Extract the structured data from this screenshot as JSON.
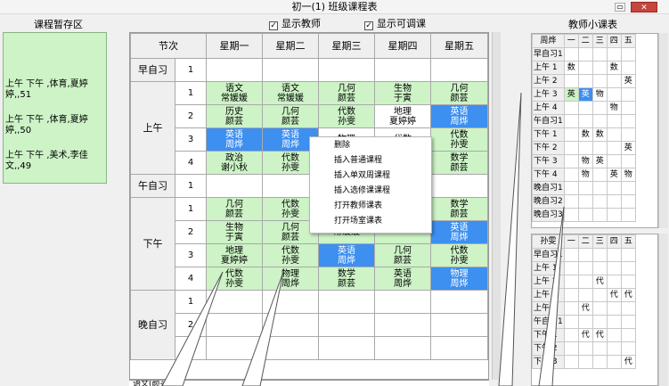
{
  "window": {
    "title": "初一(1) 班级课程表",
    "min": "▭",
    "close": "✕"
  },
  "pool": {
    "label": "课程暂存区",
    "items": [
      "上午 下午 ,体育,夏婷婷,,51",
      "上午 下午 ,体育,夏婷婷,,50",
      "上午 下午 ,美术,李佳文,,49"
    ]
  },
  "options": {
    "show_teacher": "显示教师",
    "show_adjustable": "显示可调课",
    "check": "✓"
  },
  "mini": {
    "label": "教师小课表"
  },
  "grid": {
    "header": [
      "节次",
      "星期一",
      "星期二",
      "星期三",
      "星期四",
      "星期五"
    ],
    "sections": [
      "早自习",
      "上午",
      "午自习",
      "下午",
      "晚自习"
    ],
    "nums": [
      "1",
      "1",
      "2",
      "3",
      "4",
      "1",
      "1",
      "2",
      "3",
      "4",
      "1",
      "2",
      "3"
    ],
    "cells": [
      [
        "",
        "",
        "",
        "",
        ""
      ],
      [
        "语文\n常媛媛",
        "语文\n常媛媛",
        "几何\n颜芸",
        "生物\n于寅",
        "几何\n颜芸"
      ],
      [
        "历史\n颜芸",
        "几何\n颜芸",
        "代数\n孙雯",
        "地理\n夏婷婷",
        "英语\n周烨"
      ],
      [
        "英语\n周烨",
        "英语\n周烨",
        "物理\n",
        "代数\n",
        "代数\n孙雯"
      ],
      [
        "政治\n谢小秋",
        "代数\n孙雯",
        "",
        "",
        "数学\n颜芸"
      ],
      [
        "",
        "",
        "",
        "",
        ""
      ],
      [
        "几何\n颜芸",
        "代数\n孙雯",
        "",
        "",
        "数学\n颜芸"
      ],
      [
        "生物\n于寅",
        "几何\n颜芸",
        "常媛媛",
        "",
        "英语\n周烨"
      ],
      [
        "地理\n夏婷婷",
        "代数\n孙雯",
        "英语\n周烨",
        "几何\n颜芸",
        "代数\n孙雯"
      ],
      [
        "代数\n孙雯",
        "物理\n周烨",
        "数学\n颜芸",
        "英语\n周烨",
        "物理\n周烨"
      ],
      [
        "",
        "",
        "",
        "",
        ""
      ],
      [
        "",
        "",
        "",
        "",
        ""
      ],
      [
        "",
        "",
        "",
        "",
        ""
      ]
    ]
  },
  "context_menu": [
    "删除",
    "插入普通课程",
    "插入单双周课程",
    "插入选修课课程",
    "打开教师课表",
    "打开场室课表"
  ],
  "status": "语文(颜芸)",
  "teacher1": {
    "name": "周烨",
    "days": [
      "一",
      "二",
      "三",
      "四",
      "五"
    ],
    "rows": [
      [
        "早自习1",
        "",
        "",
        "",
        "",
        ""
      ],
      [
        "上午 1",
        "数",
        "",
        "",
        "数",
        ""
      ],
      [
        "上午 2",
        "",
        "",
        "",
        "",
        "英"
      ],
      [
        "上午 3",
        "英",
        "英",
        "物",
        "",
        ""
      ],
      [
        "上午 4",
        "",
        "",
        "",
        "物",
        ""
      ],
      [
        "午自习1",
        "",
        "",
        "",
        "",
        ""
      ],
      [
        "下午 1",
        "",
        "数",
        "数",
        "",
        ""
      ],
      [
        "下午 2",
        "",
        "",
        "",
        "",
        "英"
      ],
      [
        "下午 3",
        "",
        "物",
        "英",
        "",
        ""
      ],
      [
        "下午 4",
        "",
        "物",
        "",
        "英",
        "物"
      ],
      [
        "晚自习1",
        "",
        "",
        "",
        "",
        ""
      ],
      [
        "晚自习2",
        "",
        "",
        "",
        "",
        ""
      ],
      [
        "晚自习3",
        "",
        "",
        "",
        "",
        ""
      ]
    ]
  },
  "teacher2": {
    "name": "孙雯",
    "days": [
      "一",
      "二",
      "三",
      "四",
      "五"
    ],
    "rows": [
      [
        "早自习1",
        "",
        "",
        "",
        "",
        ""
      ],
      [
        "上午 1",
        "",
        "",
        "",
        "",
        ""
      ],
      [
        "上午 2",
        "",
        "",
        "代",
        "",
        ""
      ],
      [
        "上午 3",
        "",
        "",
        "",
        "代",
        "代"
      ],
      [
        "上午 4",
        "",
        "代",
        "",
        "",
        ""
      ],
      [
        "午自习1",
        "",
        "",
        "",
        "",
        ""
      ],
      [
        "下午 1",
        "",
        "代",
        "代",
        "",
        ""
      ],
      [
        "下午 2",
        "",
        "",
        "",
        "",
        ""
      ],
      [
        "下午 3",
        "",
        "",
        "",
        "",
        "代"
      ]
    ]
  }
}
